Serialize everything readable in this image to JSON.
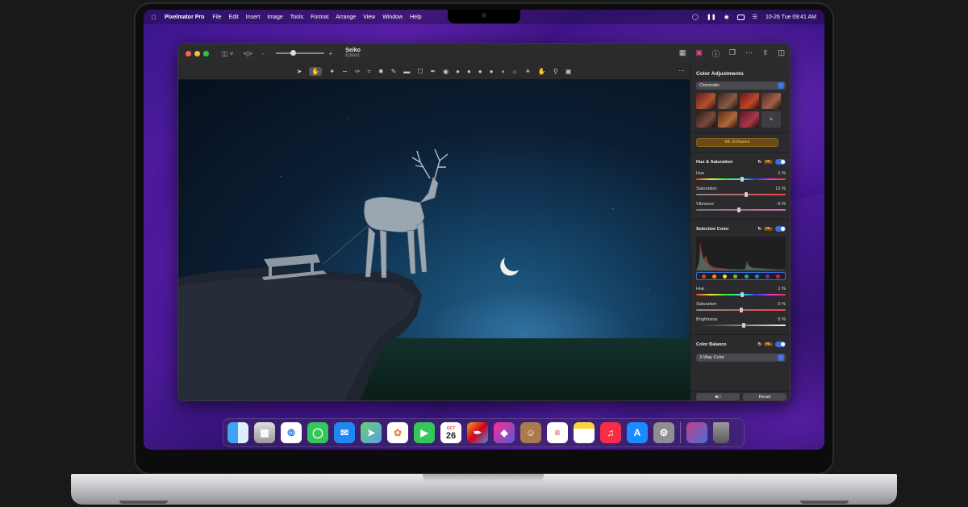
{
  "menubar": {
    "apple": "",
    "app_name": "Pixelmator Pro",
    "menus": [
      "File",
      "Edit",
      "Insert",
      "Image",
      "Tools",
      "Format",
      "Arrange",
      "View",
      "Window",
      "Help"
    ],
    "clock": "10-26 Tue  09:41 AM"
  },
  "window": {
    "doc_title": "Seiko",
    "doc_status": "Edited"
  },
  "panel": {
    "title": "Color Adjustments",
    "preset": "Cinematic",
    "ml_enhance": "ML Enhance",
    "hue_saturation": {
      "title": "Hue & Saturation",
      "ml_badge": "ML",
      "hue_label": "Hue",
      "hue_value": "1 %",
      "hue_level": 0.51,
      "saturation_label": "Saturation",
      "saturation_value": "12 %",
      "saturation_level": 0.56,
      "vibrance_label": "Vibrance",
      "vibrance_value": "-3 %",
      "vibrance_level": 0.48
    },
    "selective_color": {
      "title": "Selective Color",
      "ml_badge": "ML",
      "hue_label": "Hue",
      "hue_value": "1 %",
      "hue_level": 0.51,
      "saturation_label": "Saturation",
      "saturation_value": "0 %",
      "saturation_level": 0.5,
      "brightness_label": "Brightness",
      "brightness_value": "5 %",
      "brightness_level": 0.53,
      "swatch_colors": [
        "#e53935",
        "#fb8c00",
        "#fdd835",
        "#7cb342",
        "#26a69a",
        "#1e88e5",
        "#5e35b1",
        "#d81b60"
      ]
    },
    "color_balance": {
      "title": "Color Balance",
      "ml_badge": "ML",
      "mode": "3-Way Color"
    },
    "reset_label": "Reset"
  },
  "dock": {
    "calendar_month": "OCT",
    "calendar_day": "26",
    "apps": [
      "finder-icon",
      "launchpad-icon",
      "safari-icon",
      "messages-icon",
      "mail-icon",
      "maps-icon",
      "photos-icon",
      "facetime-icon",
      "calendar-icon",
      "pixelmator-icon",
      "shortcuts-icon",
      "contacts-icon",
      "reminders-icon",
      "notes-icon",
      "music-icon",
      "app-store-icon",
      "system-preferences-icon"
    ]
  }
}
